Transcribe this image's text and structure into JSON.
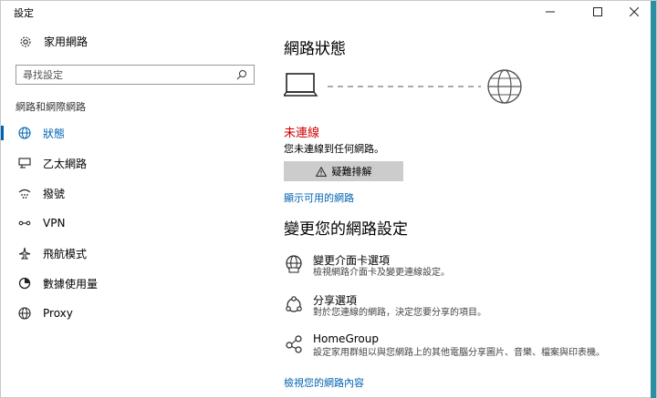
{
  "window": {
    "title": "設定"
  },
  "sidebar": {
    "home_label": "家用網路",
    "search_placeholder": "尋找設定",
    "section_label": "網路和網際網路",
    "items": [
      {
        "label": "狀態",
        "icon": "globe-network-icon",
        "active": true
      },
      {
        "label": "乙太網路",
        "icon": "ethernet-icon",
        "active": false
      },
      {
        "label": "撥號",
        "icon": "dialup-icon",
        "active": false
      },
      {
        "label": "VPN",
        "icon": "vpn-icon",
        "active": false
      },
      {
        "label": "飛航模式",
        "icon": "airplane-icon",
        "active": false
      },
      {
        "label": "數據使用量",
        "icon": "data-usage-icon",
        "active": false
      },
      {
        "label": "Proxy",
        "icon": "globe-icon",
        "active": false
      }
    ]
  },
  "main": {
    "heading": "網路狀態",
    "status_title": "未連線",
    "status_subtitle": "您未連線到任何網路。",
    "troubleshoot_label": "疑難排解",
    "show_networks_link": "顯示可用的網路",
    "change_heading": "變更您的網路設定",
    "settings": [
      {
        "title": "變更介面卡選項",
        "desc": "檢視網路介面卡及變更連線設定。",
        "icon": "adapter-globe-icon"
      },
      {
        "title": "分享選項",
        "desc": "對於您連線的網路，決定您要分享的項目。",
        "icon": "sharing-icon"
      },
      {
        "title": "HomeGroup",
        "desc": "設定家用群組以與您網路上的其他電腦分享圖片、音樂、檔案與印表機。",
        "icon": "homegroup-icon"
      }
    ],
    "view_properties_link": "檢視您的網路內容"
  },
  "colors": {
    "accent": "#0063b1",
    "error": "#d00000",
    "button_bg": "#cccccc"
  }
}
